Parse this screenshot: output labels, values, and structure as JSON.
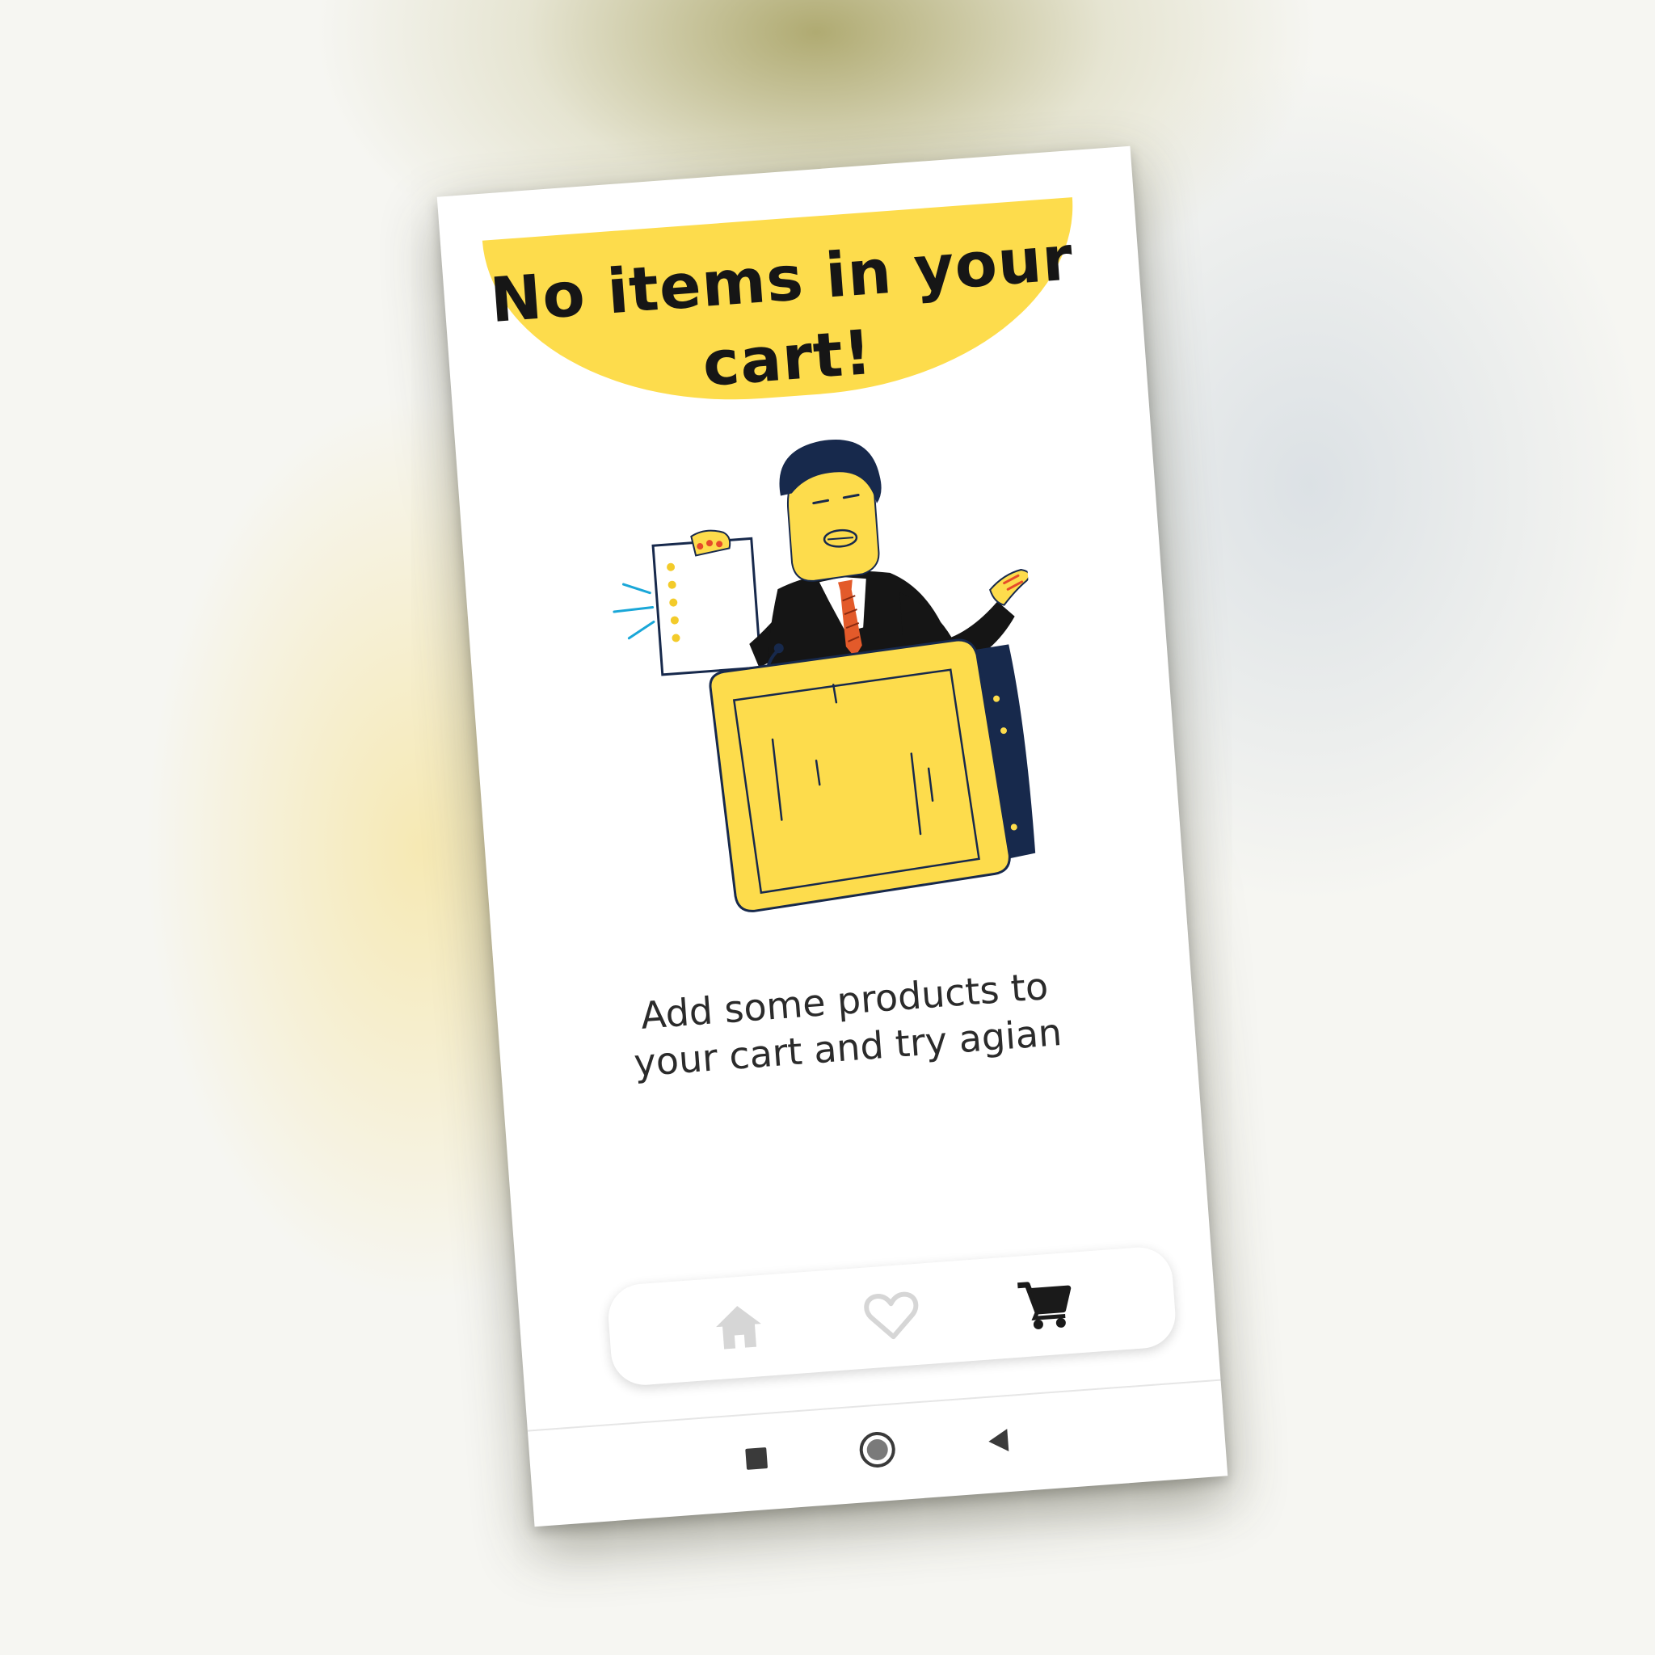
{
  "screen": {
    "title": "No items in your cart!",
    "message": "Add some products to your cart and try agian",
    "illustration": "businessman-at-podium-holding-empty-list"
  },
  "bottom_nav": {
    "items": [
      {
        "icon": "home-icon",
        "active": false
      },
      {
        "icon": "heart-icon",
        "active": false
      },
      {
        "icon": "cart-icon",
        "active": true
      }
    ]
  },
  "system_nav": {
    "items": [
      {
        "icon": "recents-square-icon"
      },
      {
        "icon": "home-circle-icon"
      },
      {
        "icon": "back-triangle-icon"
      }
    ]
  },
  "colors": {
    "accent": "#fddc4c",
    "navy": "#17294c",
    "icon_active": "#1a1a1a",
    "icon_inactive": "#d6d6d6"
  }
}
